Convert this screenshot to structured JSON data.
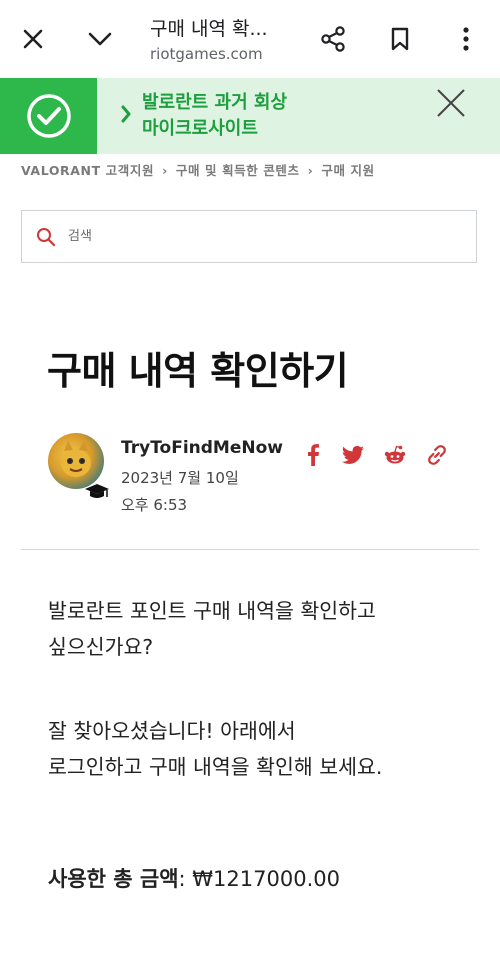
{
  "browser": {
    "page_title": "구매 내역 확...",
    "url": "riotgames.com"
  },
  "banner": {
    "line1": "발로란트 과거 회상",
    "line2": "마이크로사이트"
  },
  "breadcrumb": {
    "items": [
      "VALORANT 고객지원",
      "구매 및 획득한 콘텐츠",
      "구매 지원"
    ],
    "separator": "›"
  },
  "search": {
    "placeholder": "검색"
  },
  "article": {
    "title": "구매 내역 확인하기",
    "author": {
      "name": "TryToFindMeNow",
      "date": "2023년 7월 10일",
      "time": "오후 6:53"
    },
    "paragraphs": [
      [
        "발로란트 포인트 구매 내역을 확인하고",
        "싶으신가요?"
      ],
      [
        "잘 찾아오셨습니다! 아래에서",
        "로그인하고 구매 내역을 확인해 보세요."
      ]
    ],
    "total_label": "사용한 총 금액",
    "total_value": ": ₩1217000.00"
  },
  "colors": {
    "accent_red": "#d13639",
    "banner_green": "#2eb84b",
    "banner_bg": "#dff3e2",
    "banner_text": "#1e9e3e"
  },
  "icons": {
    "close": "close-icon",
    "chevron": "chevron-down-icon",
    "share": "share-icon",
    "bookmark": "bookmark-icon",
    "menu": "more-vert-icon",
    "check": "check-circle-icon",
    "search": "search-icon",
    "facebook": "facebook-icon",
    "twitter": "twitter-icon",
    "reddit": "reddit-icon",
    "link": "link-icon"
  }
}
